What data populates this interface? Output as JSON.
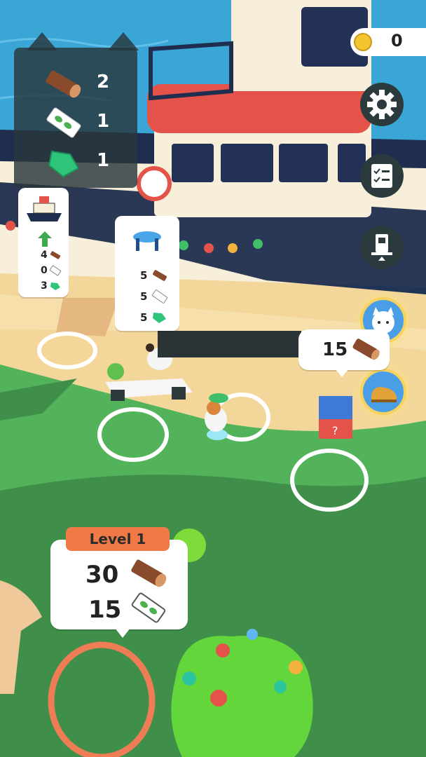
{
  "hud": {
    "inventory": [
      {
        "icon": "log-icon",
        "count": "2"
      },
      {
        "icon": "leaf-paper-icon",
        "count": "1"
      },
      {
        "icon": "green-gem-icon",
        "count": "1"
      }
    ],
    "coins": "0",
    "buttons": [
      "settings-icon",
      "checklist-icon",
      "upgrade-station-icon",
      "cat-helper-icon",
      "shoe-icon"
    ]
  },
  "ship_card": {
    "upgrade": "4",
    "cost_paper": "0",
    "cost_gem": "3"
  },
  "table_card": {
    "cost_log": "5",
    "cost_paper": "5",
    "cost_gem": "5"
  },
  "box_bubble": {
    "cost_log": "15"
  },
  "level_bubble": {
    "level_label": "Level 1",
    "cost_log": "30",
    "cost_paper": "15"
  },
  "colors": {
    "sea": "#3aa8d8",
    "grass": "#3f8f4a",
    "sand": "#f3d79a",
    "accent": "#ef7a45",
    "hull": "#1f2d4f"
  }
}
